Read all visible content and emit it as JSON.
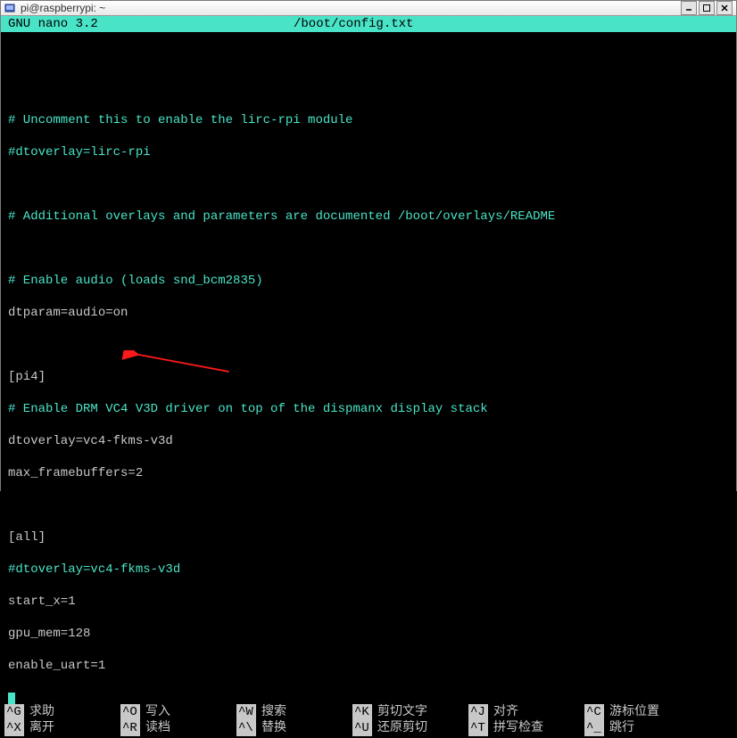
{
  "window": {
    "title": "pi@raspberrypi: ~"
  },
  "nano": {
    "app": "GNU nano 3.2",
    "file": "/boot/config.txt"
  },
  "lines": {
    "l1": "# Uncomment this to enable the lirc-rpi module",
    "l2": "#dtoverlay=lirc-rpi",
    "l3": "# Additional overlays and parameters are documented /boot/overlays/README",
    "l4": "# Enable audio (loads snd_bcm2835)",
    "l5": "dtparam=audio=on",
    "l6": "[pi4]",
    "l7": "# Enable DRM VC4 V3D driver on top of the dispmanx display stack",
    "l8": "dtoverlay=vc4-fkms-v3d",
    "l9": "max_framebuffers=2",
    "l10": "[all]",
    "l11": "#dtoverlay=vc4-fkms-v3d",
    "l12": "start_x=1",
    "l13": "gpu_mem=128",
    "l14": "enable_uart=1"
  },
  "shortcuts": {
    "r1": {
      "k1": "^G",
      "t1": "求助",
      "k2": "^O",
      "t2": "写入",
      "k3": "^W",
      "t3": "搜索",
      "k4": "^K",
      "t4": "剪切文字",
      "k5": "^J",
      "t5": "对齐",
      "k6": "^C",
      "t6": "游标位置"
    },
    "r2": {
      "k1": "^X",
      "t1": "离开",
      "k2": "^R",
      "t2": "读档",
      "k3": "^\\",
      "t3": "替换",
      "k4": "^U",
      "t4": "还原剪切",
      "k5": "^T",
      "t5": "拼写检查",
      "k6": "^_",
      "t6": "跳行"
    }
  }
}
